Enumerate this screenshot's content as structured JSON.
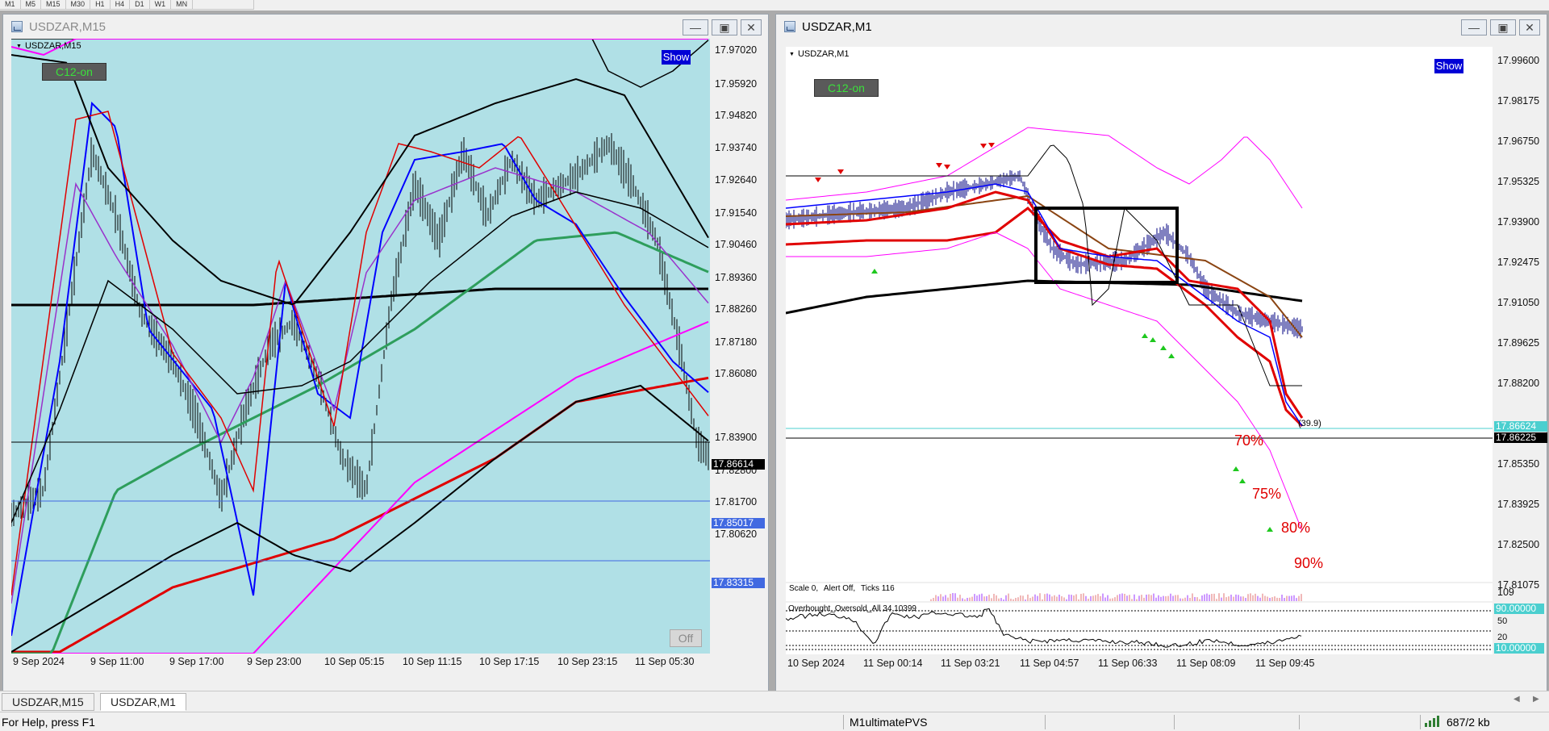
{
  "timeframes": [
    "M1",
    "M5",
    "M15",
    "M30",
    "H1",
    "H4",
    "D1",
    "W1",
    "MN"
  ],
  "colors": {
    "left_bg": "#b0e0e6",
    "right_bg": "#ffffff",
    "price_line": "#000080",
    "bid_label": "#000000",
    "line_label": "#4169e1",
    "ask_label": "#4bcfcf"
  },
  "left_window": {
    "title": "USDZAR,M15",
    "symbol": "USDZAR,M15",
    "c12": "C12-on",
    "show": "Show",
    "off": "Off",
    "buttons": {
      "minimize": "—",
      "restore": "▣",
      "close": "✕"
    },
    "price_ticks": [
      "17.97020",
      "17.95920",
      "17.94820",
      "17.93740",
      "17.92640",
      "17.91540",
      "17.90460",
      "17.89360",
      "17.88260",
      "17.87180",
      "17.86080",
      "17.83900",
      "17.82800",
      "17.81700",
      "17.80620"
    ],
    "bid": "17.86614",
    "line1": "17.85017",
    "line2": "17.83315",
    "time_ticks": [
      "9 Sep 2024",
      "9 Sep 11:00",
      "9 Sep 17:00",
      "9 Sep 23:00",
      "10 Sep 05:15",
      "10 Sep 11:15",
      "10 Sep 17:15",
      "10 Sep 23:15",
      "11 Sep 05:30"
    ]
  },
  "right_window": {
    "title": "USDZAR,M1",
    "symbol": "USDZAR,M1",
    "c12": "C12-on",
    "show": "Show",
    "buttons": {
      "minimize": "—",
      "restore": "▣",
      "close": "✕"
    },
    "price_ticks": [
      "17.99600",
      "17.98175",
      "17.96750",
      "17.95325",
      "17.93900",
      "17.92475",
      "17.91050",
      "17.89625",
      "17.88200",
      "17.85350",
      "17.83925",
      "17.82500",
      "17.81075"
    ],
    "ask": "17.86624",
    "bid": "17.86225",
    "fib_label": "(39.9)",
    "percent_labels": [
      "70%",
      "75%",
      "80%",
      "90%"
    ],
    "volume_info": {
      "scale": "Scale  0,",
      "alert": "Alert Off,",
      "ticks": "Ticks  116"
    },
    "volume_max": "109",
    "osc_label": "Overbought_Oversold_All 34 10399",
    "osc_levels": [
      "90.00000",
      "50",
      "20",
      "10.00000"
    ],
    "time_ticks": [
      "10 Sep 2024",
      "11 Sep 00:14",
      "11 Sep 03:21",
      "11 Sep 04:57",
      "11 Sep 06:33",
      "11 Sep 08:09",
      "11 Sep 09:45"
    ]
  },
  "tabs": [
    "USDZAR,M15",
    "USDZAR,M1"
  ],
  "status": {
    "help": "For Help, press F1",
    "profile": "M1ultimatePVS",
    "traffic": "687/2 kb"
  }
}
